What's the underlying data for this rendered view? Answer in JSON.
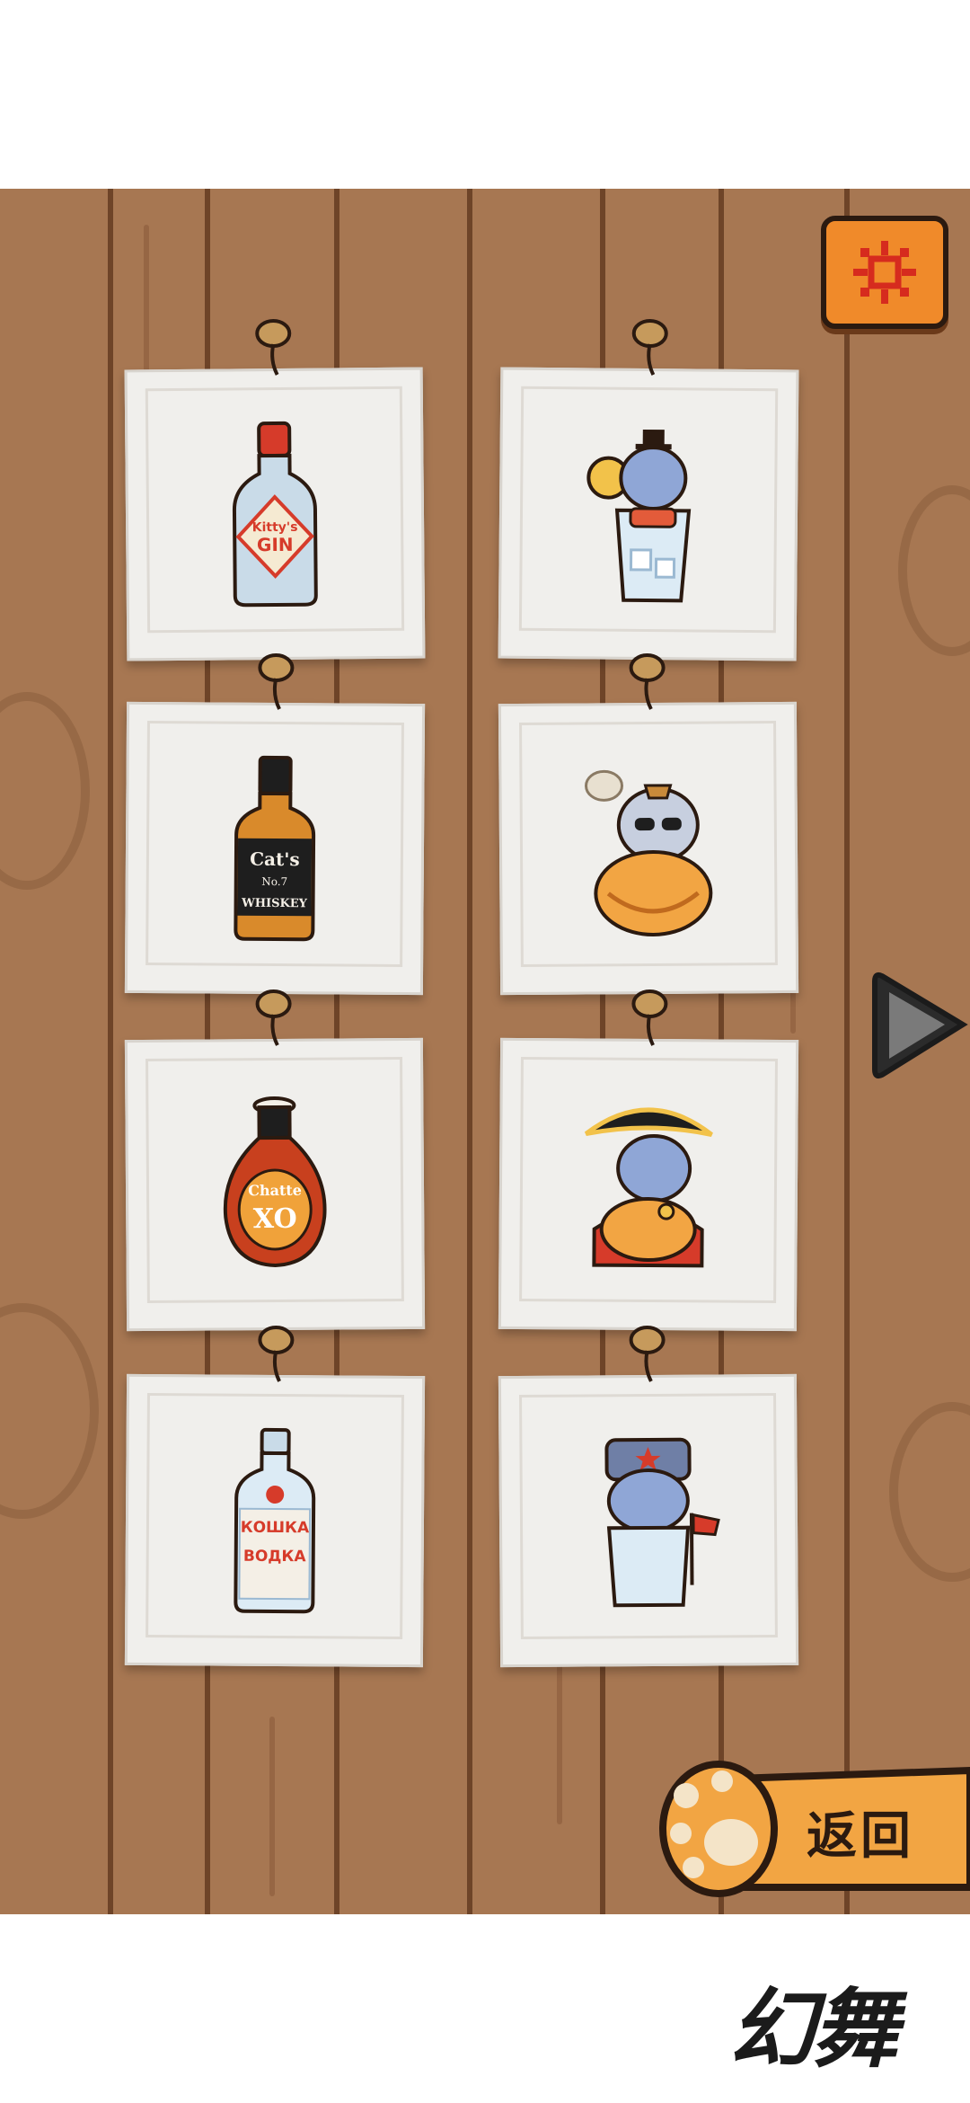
{
  "colors": {
    "wood": "#a77752",
    "card": "#f0efec",
    "accent_orange": "#f08a2a",
    "outline": "#2b1a10"
  },
  "top_bar": {
    "settings_icon": "gear-icon"
  },
  "collection": {
    "items": [
      {
        "name": "gin-bottle",
        "label_line1": "Kitty's",
        "label_line2": "GIN",
        "label_number": ""
      },
      {
        "name": "gin-cat",
        "label_line1": "",
        "label_line2": "",
        "label_number": ""
      },
      {
        "name": "whiskey-bottle",
        "label_line1": "Cat's",
        "label_line2": "WHISKEY",
        "label_number": "No.7"
      },
      {
        "name": "whiskey-cat",
        "label_line1": "",
        "label_line2": "",
        "label_number": ""
      },
      {
        "name": "cognac-bottle",
        "label_line1": "Chatte",
        "label_line2": "XO",
        "label_number": ""
      },
      {
        "name": "cognac-cat",
        "label_line1": "",
        "label_line2": "",
        "label_number": ""
      },
      {
        "name": "vodka-bottle",
        "label_line1": "КОШКА",
        "label_line2": "ВОДКА",
        "label_number": ""
      },
      {
        "name": "vodka-cat",
        "label_line1": "",
        "label_line2": "",
        "label_number": ""
      }
    ]
  },
  "navigation": {
    "next_icon": "play-arrow-icon",
    "back_label": "返回",
    "back_icon": "paw-icon"
  },
  "watermark": {
    "text": "幻舞"
  }
}
